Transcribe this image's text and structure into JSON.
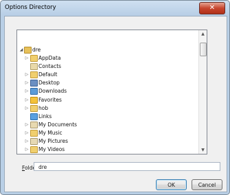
{
  "window": {
    "title": "Options Directory",
    "close_glyph": "✕"
  },
  "tree": {
    "root": {
      "label": "dre",
      "icon": "user-folder-icon"
    },
    "items": [
      {
        "label": "AppData",
        "icon": "folder-icon"
      },
      {
        "label": "Contacts",
        "icon": "contacts-folder-icon"
      },
      {
        "label": "Default",
        "icon": "folder-icon"
      },
      {
        "label": "Desktop",
        "icon": "desktop-folder-icon"
      },
      {
        "label": "Downloads",
        "icon": "downloads-folder-icon"
      },
      {
        "label": "Favorites",
        "icon": "favorites-folder-icon"
      },
      {
        "label": "hob",
        "icon": "folder-icon"
      },
      {
        "label": "Links",
        "icon": "links-folder-icon"
      },
      {
        "label": "My Documents",
        "icon": "documents-folder-icon"
      },
      {
        "label": "My Music",
        "icon": "music-folder-icon"
      },
      {
        "label": "My Pictures",
        "icon": "pictures-folder-icon"
      },
      {
        "label": "My Videos",
        "icon": "videos-folder-icon"
      }
    ],
    "scroll_up_glyph": "▲",
    "scroll_down_glyph": "▼"
  },
  "folder": {
    "label_prefix": "F",
    "label_rest": "older:",
    "value": "dre"
  },
  "buttons": {
    "ok": "OK",
    "cancel": "Cancel"
  }
}
